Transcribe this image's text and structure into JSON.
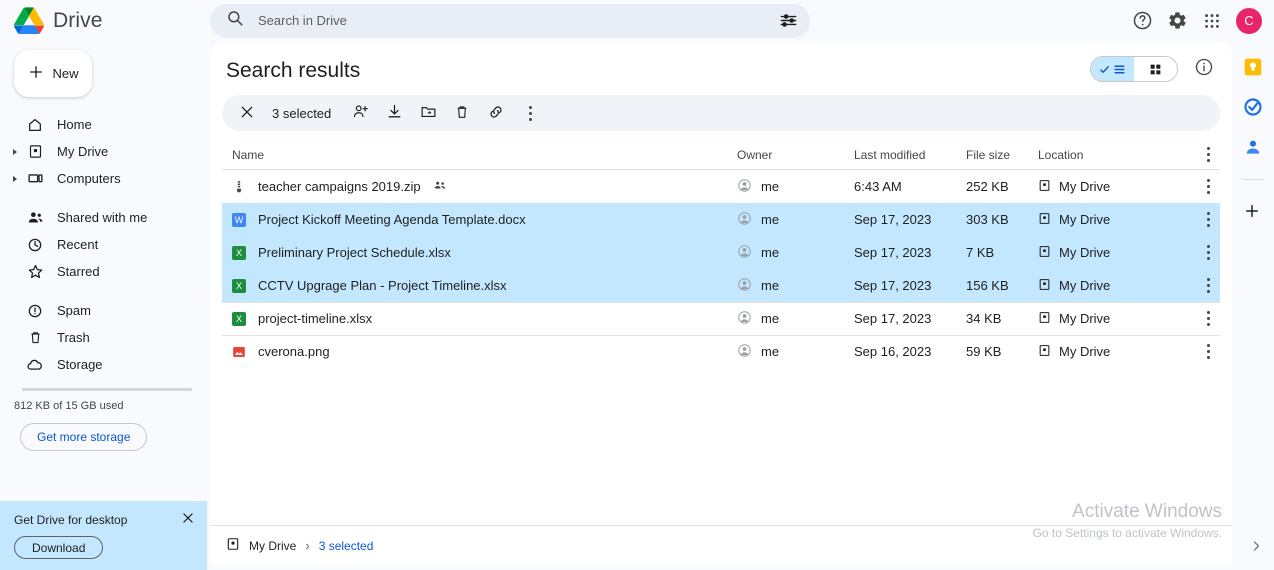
{
  "app": {
    "brand_name": "Drive",
    "logo_icon": "drive-logo-icon"
  },
  "search": {
    "placeholder": "Search in Drive",
    "value": "",
    "search_icon": "search-icon",
    "filter_icon": "tune-filter-icon"
  },
  "topbar_actions": {
    "help_icon": "help-circle-icon",
    "settings_icon": "gear-icon",
    "apps_icon": "apps-grid-icon",
    "avatar_letter": "C",
    "avatar_color": "#e8246a"
  },
  "sidebar": {
    "new_button": "New",
    "new_icon": "plus-icon",
    "items": [
      {
        "label": "Home",
        "icon": "home-icon",
        "expandable": false
      },
      {
        "label": "My Drive",
        "icon": "my-drive-icon",
        "expandable": true
      },
      {
        "label": "Computers",
        "icon": "computers-icon",
        "expandable": true
      },
      {
        "label": "Shared with me",
        "icon": "shared-people-icon",
        "expandable": false
      },
      {
        "label": "Recent",
        "icon": "clock-icon",
        "expandable": false
      },
      {
        "label": "Starred",
        "icon": "star-icon",
        "expandable": false
      },
      {
        "label": "Spam",
        "icon": "spam-alert-icon",
        "expandable": false
      },
      {
        "label": "Trash",
        "icon": "trash-icon",
        "expandable": false
      },
      {
        "label": "Storage",
        "icon": "cloud-icon",
        "expandable": false
      }
    ],
    "storage_text": "812 KB of 15 GB used",
    "storage_button": "Get more storage",
    "promo": {
      "title": "Get Drive for desktop",
      "download_button": "Download",
      "close_icon": "close-icon"
    }
  },
  "main": {
    "page_title": "Search results",
    "view_toggle": {
      "list_label": "list-view",
      "grid_label": "grid-view",
      "active": "list",
      "active_color": "#c2e7ff"
    },
    "info_icon": "info-circle-icon",
    "toolbar": {
      "close_icon": "close-icon",
      "selected_text": "3 selected",
      "actions": [
        {
          "name": "share-add-person",
          "icon": "person-add-icon"
        },
        {
          "name": "download",
          "icon": "download-icon"
        },
        {
          "name": "move-to-folder",
          "icon": "move-folder-icon"
        },
        {
          "name": "remove",
          "icon": "trash-icon"
        },
        {
          "name": "get-link",
          "icon": "link-icon"
        },
        {
          "name": "more-actions",
          "icon": "more-vertical-icon"
        }
      ]
    },
    "columns": {
      "name": "Name",
      "owner": "Owner",
      "last_modified": "Last modified",
      "file_size": "File size",
      "location": "Location",
      "more_icon": "more-vertical-icon"
    },
    "files": [
      {
        "name": "teacher campaigns 2019.zip",
        "type_icon": "zip-icon",
        "shared": true,
        "owner": "me",
        "last_modified": "6:43 AM",
        "file_size": "252 KB",
        "location": "My Drive",
        "selected": false
      },
      {
        "name": "Project Kickoff Meeting Agenda Template.docx",
        "type_icon": "word-icon",
        "shared": false,
        "owner": "me",
        "last_modified": "Sep 17, 2023",
        "file_size": "303 KB",
        "location": "My Drive",
        "selected": true
      },
      {
        "name": "Preliminary Project Schedule.xlsx",
        "type_icon": "excel-icon",
        "shared": false,
        "owner": "me",
        "last_modified": "Sep 17, 2023",
        "file_size": "7 KB",
        "location": "My Drive",
        "selected": true
      },
      {
        "name": "CCTV Upgrage Plan - Project Timeline.xlsx",
        "type_icon": "excel-icon",
        "shared": false,
        "owner": "me",
        "last_modified": "Sep 17, 2023",
        "file_size": "156 KB",
        "location": "My Drive",
        "selected": true
      },
      {
        "name": "project-timeline.xlsx",
        "type_icon": "excel-icon",
        "shared": false,
        "owner": "me",
        "last_modified": "Sep 17, 2023",
        "file_size": "34 KB",
        "location": "My Drive",
        "selected": false
      },
      {
        "name": "cverona.png",
        "type_icon": "image-png-icon",
        "shared": false,
        "owner": "me",
        "last_modified": "Sep 16, 2023",
        "file_size": "59 KB",
        "location": "My Drive",
        "selected": false
      }
    ],
    "footer": {
      "root_label": "My Drive",
      "root_icon": "my-drive-icon",
      "separator": "›",
      "selection_label": "3 selected"
    }
  },
  "right_rail": {
    "items": [
      {
        "name": "google-keep-icon",
        "color": "#fbbc04"
      },
      {
        "name": "google-tasks-icon",
        "color": "#1a73e8"
      },
      {
        "name": "google-contacts-icon",
        "color": "#1a73e8"
      }
    ],
    "add_icon": "plus-icon",
    "expand_icon": "chevron-right-icon"
  },
  "watermark": {
    "line1": "Activate Windows",
    "line2": "Go to Settings to activate Windows."
  }
}
